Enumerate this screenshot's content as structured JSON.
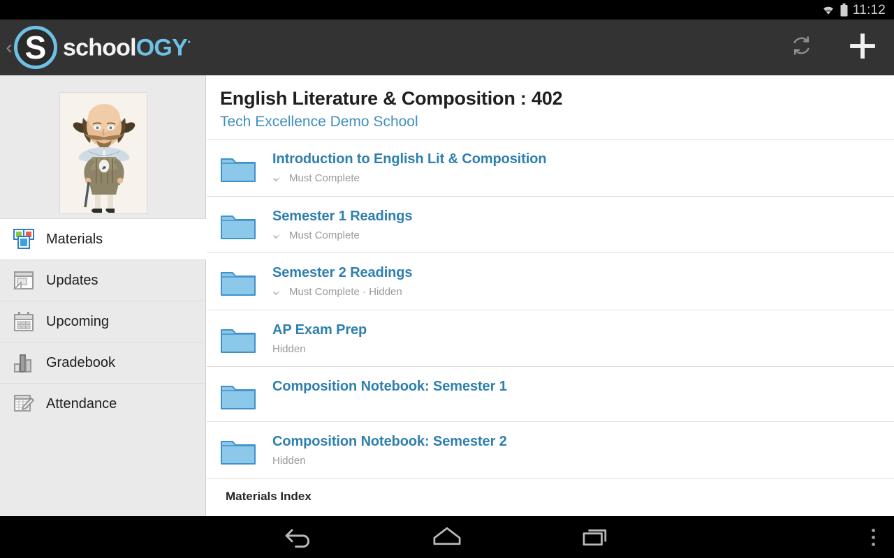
{
  "statusbar": {
    "time": "11:12",
    "wifi_icon": "wifi-icon",
    "battery_icon": "battery-icon"
  },
  "actionbar": {
    "back_chevron": "‹",
    "logo_mark": "S",
    "logo_text_white": "schoo",
    "logo_text_white2": "l",
    "logo_text_blue": "OGY",
    "logo_dot": "·",
    "refresh_icon": "refresh-icon",
    "add_icon": "plus-icon",
    "bg_color": "#333333",
    "accent_color": "#6ec1e4"
  },
  "sidebar": {
    "avatar_alt": "Shakespeare caricature course profile picture",
    "items": [
      {
        "label": "Materials",
        "icon": "materials-icon",
        "active": true
      },
      {
        "label": "Updates",
        "icon": "updates-icon",
        "active": false
      },
      {
        "label": "Upcoming",
        "icon": "calendar-icon",
        "active": false
      },
      {
        "label": "Gradebook",
        "icon": "bar-chart-icon",
        "active": false
      },
      {
        "label": "Attendance",
        "icon": "attendance-icon",
        "active": false
      }
    ]
  },
  "main": {
    "course_title": "English Literature & Composition : 402",
    "course_subtitle": "Tech Excellence Demo School",
    "subtitle_color": "#3f8fbf",
    "link_color": "#2e7fae",
    "items": [
      {
        "title": "Introduction to English Lit & Composition",
        "meta": "Must Complete",
        "has_check": true
      },
      {
        "title": "Semester 1 Readings",
        "meta": "Must Complete",
        "has_check": true
      },
      {
        "title": "Semester 2 Readings",
        "meta": "Must Complete · Hidden",
        "has_check": true
      },
      {
        "title": "AP Exam Prep",
        "meta": "Hidden",
        "has_check": false
      },
      {
        "title": "Composition Notebook: Semester 1",
        "meta": "",
        "has_check": false
      },
      {
        "title": "Composition Notebook: Semester 2",
        "meta": "Hidden",
        "has_check": false
      }
    ],
    "index_label": "Materials Index"
  },
  "navbar": {
    "back_label": "back-icon",
    "home_label": "home-icon",
    "recents_label": "recents-icon",
    "overflow_label": "overflow-menu-icon"
  }
}
